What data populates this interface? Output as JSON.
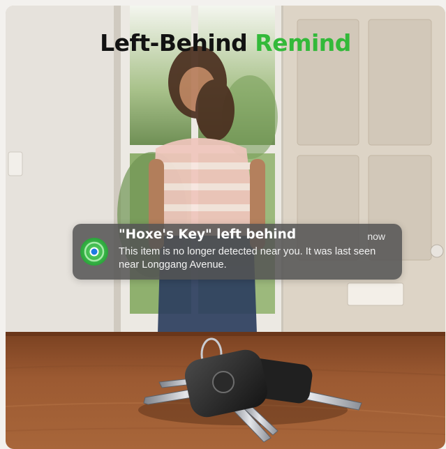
{
  "headline": {
    "part1": "Left-Behind",
    "part2": "Remind",
    "accent_color": "#33b93a"
  },
  "notification": {
    "app_icon": "find-my-icon",
    "title": "\"Hoxe's Key\" left behind",
    "time": "now",
    "body": "This item is no longer detected near you. It was last seen near Longgang Avenue."
  },
  "scene": {
    "description_icons": [
      "keys-illustration",
      "tracker-tag-icon"
    ]
  }
}
